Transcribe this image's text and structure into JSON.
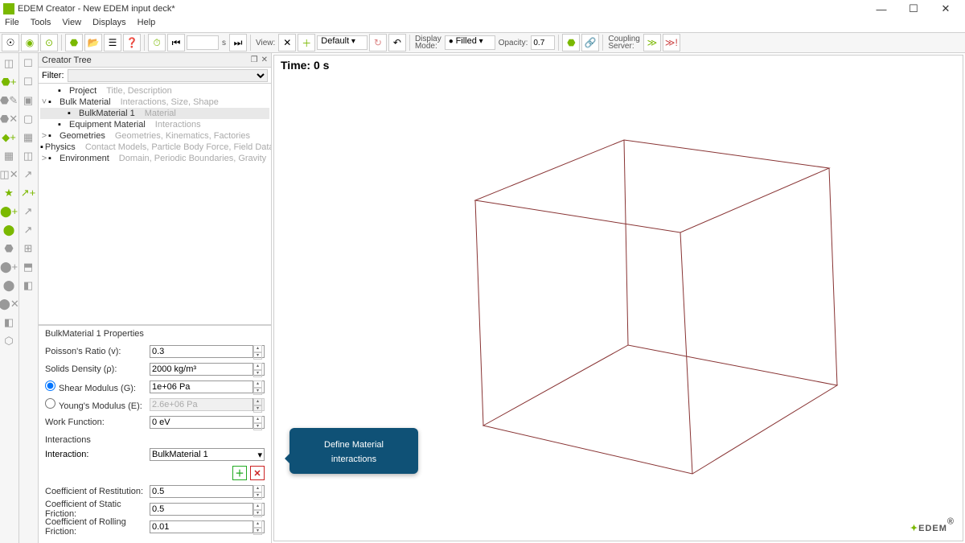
{
  "window": {
    "title": "EDEM Creator - New EDEM input deck*"
  },
  "menu": {
    "items": [
      "File",
      "Tools",
      "View",
      "Displays",
      "Help"
    ]
  },
  "toolbar": {
    "seconds_suffix": "s",
    "view_label": "View:",
    "default_label": "Default",
    "display_mode_label": "Display\nMode:",
    "display_mode_value": "Filled",
    "opacity_label": "Opacity:",
    "opacity_value": "0.7",
    "coupling_label": "Coupling\nServer:"
  },
  "panel": {
    "title": "Creator Tree",
    "filter_label": "Filter:"
  },
  "tree": [
    {
      "indent": 12,
      "exp": "",
      "label": "Project",
      "desc": "Title, Description",
      "sel": false
    },
    {
      "indent": 0,
      "exp": "˅",
      "label": "Bulk Material",
      "desc": "Interactions, Size, Shape",
      "sel": false
    },
    {
      "indent": 24,
      "exp": "",
      "label": "BulkMaterial 1",
      "desc": "Material",
      "sel": true
    },
    {
      "indent": 12,
      "exp": "",
      "label": "Equipment Material",
      "desc": "Interactions",
      "sel": false
    },
    {
      "indent": 0,
      "exp": "˃",
      "label": "Geometries",
      "desc": "Geometries, Kinematics, Factories",
      "sel": false
    },
    {
      "indent": 12,
      "exp": "",
      "label": "Physics",
      "desc": "Contact Models, Particle Body Force, Field Data",
      "sel": false
    },
    {
      "indent": 0,
      "exp": "˃",
      "label": "Environment",
      "desc": "Domain, Periodic Boundaries, Gravity",
      "sel": false
    }
  ],
  "props": {
    "title": "BulkMaterial 1 Properties",
    "poisson_label": "Poisson's Ratio (v):",
    "poisson_value": "0.3",
    "density_label": "Solids Density (ρ):",
    "density_value": "2000 kg/m³",
    "shear_label": "Shear Modulus (G):",
    "shear_value": "1e+06 Pa",
    "young_label": "Young's Modulus (E):",
    "young_value": "2.6e+06 Pa",
    "work_label": "Work Function:",
    "work_value": "0 eV",
    "interactions_label": "Interactions",
    "interaction_label": "Interaction:",
    "interaction_value": "BulkMaterial 1",
    "restitution_label": "Coefficient of Restitution:",
    "restitution_value": "0.5",
    "static_label": "Coefficient of Static Friction:",
    "static_value": "0.5",
    "rolling_label": "Coefficient of Rolling Friction:",
    "rolling_value": "0.01"
  },
  "viewport": {
    "time": "Time: 0 s",
    "logo": "EDEM"
  },
  "callout": {
    "text": "Define Material interactions"
  }
}
